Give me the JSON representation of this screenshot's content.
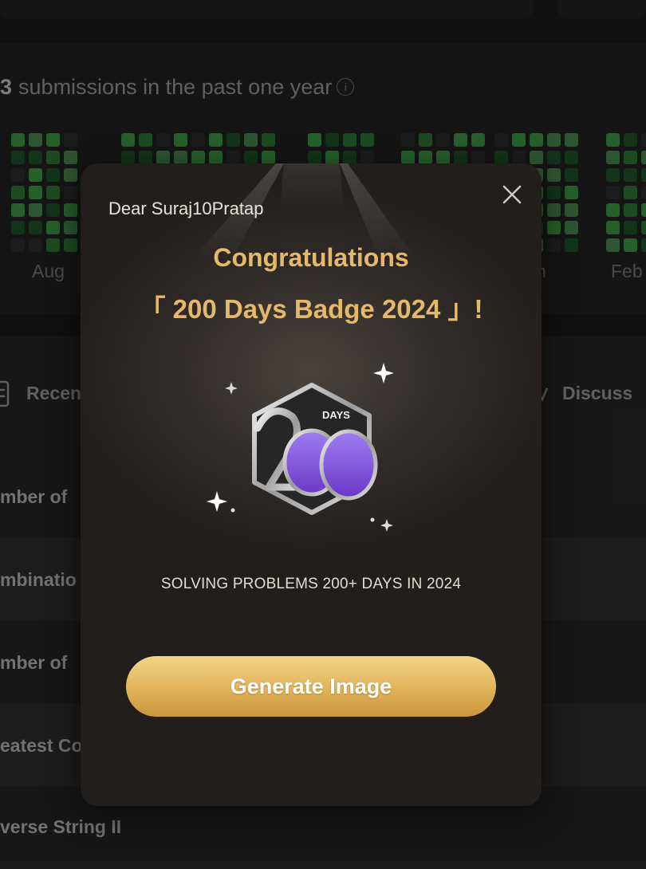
{
  "background": {
    "submissions": {
      "count": "3",
      "text": "submissions in the past one year",
      "info_icon": "info-icon"
    },
    "months": [
      "Aug",
      "Feb",
      "n"
    ],
    "tabs": {
      "recent_label": "Recen",
      "discuss_label": "Discuss"
    },
    "rows": [
      "mber of",
      "mbinatio",
      "mber of",
      "eatest Co",
      "verse String II"
    ]
  },
  "modal": {
    "greeting": "Dear Suraj10Pratap",
    "congrats": "Congratulations",
    "badge_title": "「 200 Days Badge 2024 」!",
    "badge_days_label": "DAYS",
    "description": "SOLVING PROBLEMS 200+ DAYS IN 2024",
    "generate_button": "Generate Image",
    "close_icon": "close-icon"
  },
  "colors": {
    "accent_gold": "#e6b96a",
    "badge_purple": "#7a4fd6",
    "heat_green": "#2f7a36"
  }
}
